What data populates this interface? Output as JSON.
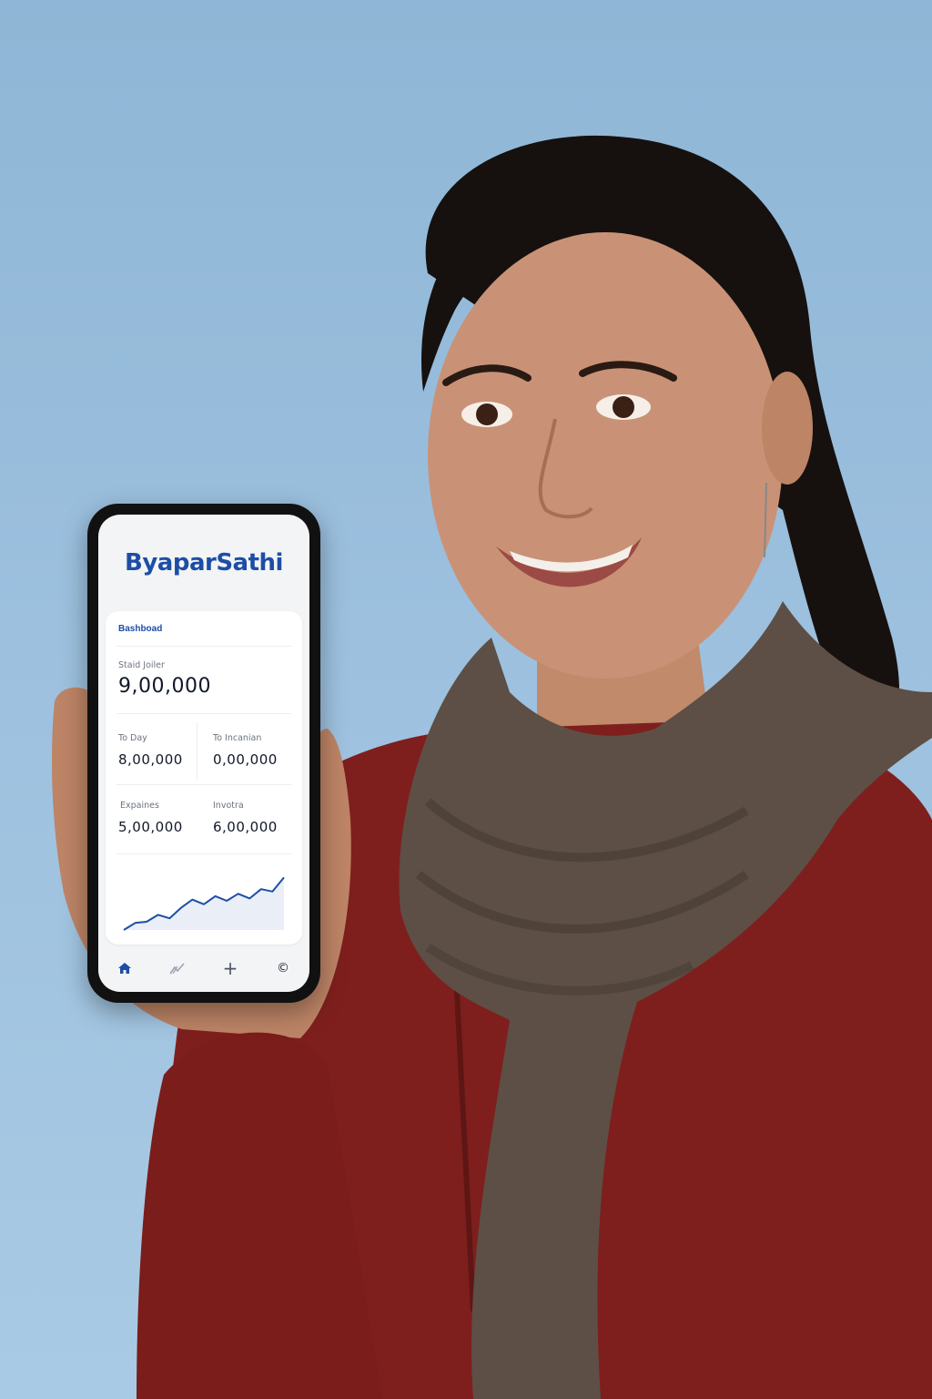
{
  "app": {
    "name": "ByaparSathi",
    "brand_color": "#1d4ea6"
  },
  "dashboard": {
    "title": "Bashboad",
    "total": {
      "label": "Staid Joiler",
      "value": "9,00,000"
    },
    "stats": [
      {
        "label": "To Day",
        "value": "8,00,000"
      },
      {
        "label": "To Incanian",
        "value": "0,00,000"
      },
      {
        "label": "Expaines",
        "value": "5,00,000"
      },
      {
        "label": "Invotra",
        "value": "6,00,000"
      }
    ]
  },
  "chart_data": {
    "type": "line",
    "title": "",
    "xlabel": "",
    "ylabel": "",
    "y": [
      0,
      12,
      14,
      26,
      20,
      38,
      52,
      44,
      58,
      50,
      62,
      54,
      70,
      66,
      90
    ],
    "ylim": [
      0,
      100
    ],
    "grid": false,
    "color": "#1d4ea6"
  },
  "nav": {
    "items": [
      {
        "icon": "home-icon",
        "active": true
      },
      {
        "icon": "analytics-icon",
        "active": false
      },
      {
        "icon": "plus-icon",
        "glyph": "+",
        "active": false
      },
      {
        "icon": "currency-icon",
        "glyph": "©",
        "active": false
      }
    ]
  }
}
